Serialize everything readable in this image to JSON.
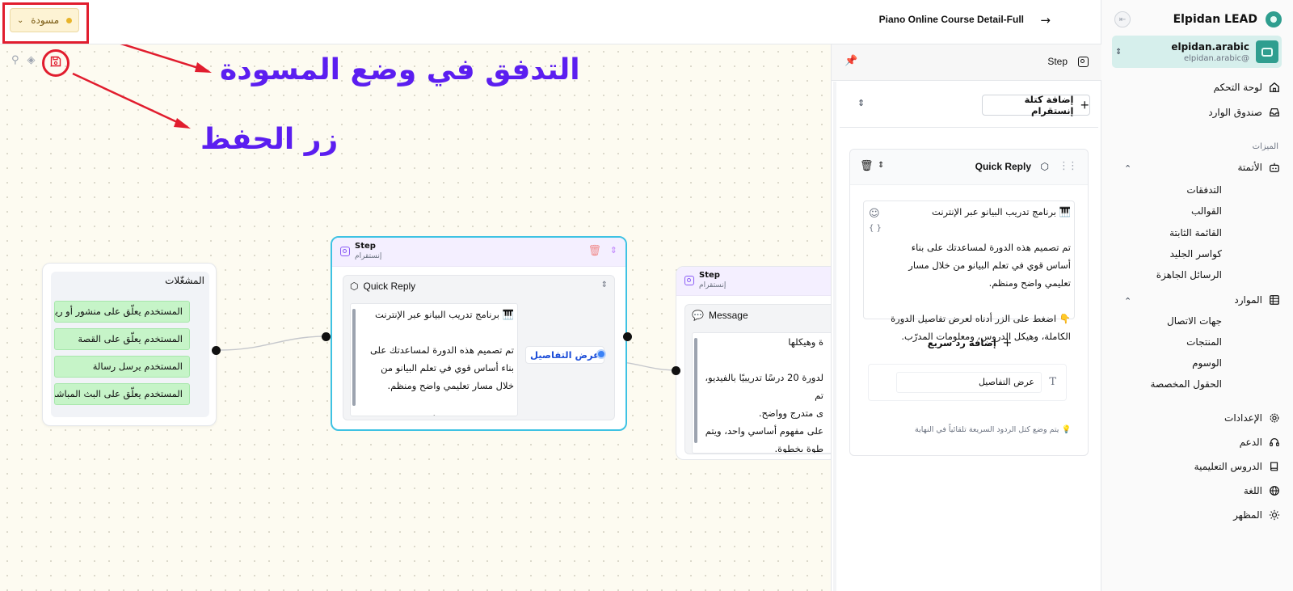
{
  "sidebar": {
    "brand": "Elpidan LEAD",
    "account_name": "elpidan.arabic",
    "account_handle": "@elpidan.arabic",
    "nav": [
      {
        "label": "لوحة التحكم",
        "icon": "home-icon"
      },
      {
        "label": "صندوق الوارد",
        "icon": "inbox-icon"
      }
    ],
    "features_caption": "الميزات",
    "automation_label": "الأتمتة",
    "automation_items": [
      "التدفقات",
      "القوالب",
      "القائمة الثابتة",
      "كواسر الجليد",
      "الرسائل الجاهزة"
    ],
    "resources_label": "الموارد",
    "resources_items": [
      "جهات الاتصال",
      "المنتجات",
      "الوسوم",
      "الحقول المخصصة"
    ],
    "bottom_nav": [
      {
        "label": "الإعدادات",
        "icon": "gear-icon"
      },
      {
        "label": "الدعم",
        "icon": "headset-icon"
      },
      {
        "label": "الدروس التعليمية",
        "icon": "book-icon"
      },
      {
        "label": "اللغة",
        "icon": "globe-icon"
      },
      {
        "label": "المظهر",
        "icon": "sun-icon"
      }
    ]
  },
  "topbar": {
    "page_title": "Piano Online Course Detail-Full",
    "status_label": "مسودة"
  },
  "annotations": {
    "draft_mode": "التدفق في وضع المسودة",
    "save_button": "زر الحفظ"
  },
  "trigger_node": {
    "title": "المشغّلات",
    "triggers": [
      "المستخدم يعلّق على منشور أو ريل",
      "المستخدم يعلّق على القصة",
      "المستخدم يرسل رسالة",
      "المستخدم يعلّق على البث المباشر"
    ]
  },
  "step1": {
    "title": "Step",
    "subtitle": "إنستقرام",
    "block_title": "Quick Reply",
    "message": "🎹 برنامج تدريب البيانو عبر الإنترنت\n\nتم تصميم هذه الدورة لمساعدتك على بناء أساس قوي في تعلم البيانو من خلال مسار تعليمي واضح ومنظم.\n\n👇 اضغط على الزر أدناه لعرض تفاصيل الدورة الكاملة، وهيكل الدروس، ومعلومات",
    "button_label": "عرض التفاصيل"
  },
  "step2": {
    "title": "Step",
    "subtitle": "إنستقرام",
    "block_title": "Message",
    "message": "ة وهيكلها\n\nلدورة 20 درسًا تدريبيًا بالفيديو، تم\nى متدرج وواضح.\nعلى مفهوم أساسي واحد، ويتم\nطوة بخطوة.\n\nة ومركزة وسهلة المتابعة، مما"
  },
  "panel": {
    "header_title": "Step",
    "add_block_label": "إضافة كتلة إنستقرام",
    "card_title": "Quick Reply",
    "message": "🎹 برنامج تدريب البيانو عبر الإنترنت\n\nتم تصميم هذه الدورة لمساعدتك على بناء أساس قوي في تعلم البيانو من خلال مسار تعليمي واضح ومنظم.\n\n👇 اضغط على الزر أدناه لعرض تفاصيل الدورة الكاملة، وهيكل الدروس، ومعلومات المدرّب.",
    "add_quick_reply_label": "إضافة رد سريع",
    "button_value": "عرض التفاصيل",
    "hint": "💡 يتم وضع كتل الردود السريعة تلقائياً في النهاية"
  },
  "colors": {
    "accent_teal": "#2f9e8f",
    "annotation_purple": "#5b1ef0",
    "annotation_red": "#e11d2e",
    "selected_node_border": "#3ec2e3",
    "trigger_green": "#c6f4c8",
    "draft_badge": "#fdf3d4"
  }
}
